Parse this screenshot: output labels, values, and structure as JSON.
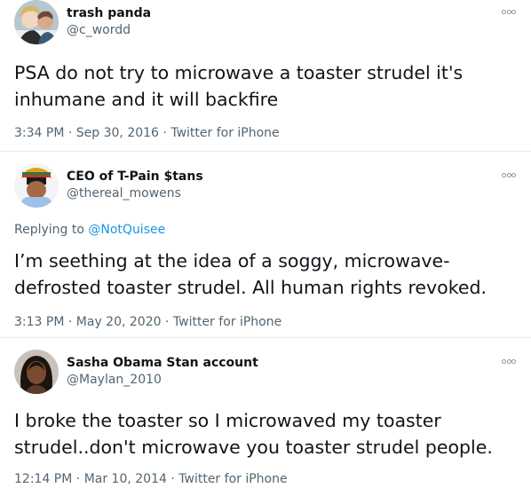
{
  "tweets": [
    {
      "display_name": "trash panda",
      "handle": "@c_wordd",
      "text": "PSA do not try to microwave a toaster strudel it's\ninhumane and it will backfire",
      "time": "3:34 PM",
      "date": "Sep 30, 2016",
      "source": "Twitter for iPhone",
      "separator": "·",
      "more_icon": "more-dots-icon"
    },
    {
      "display_name": "CEO of T-Pain $tans",
      "handle": "@thereal_mowens",
      "replying_prefix": "Replying to",
      "replying_to": "@NotQuisee",
      "text": "I’m seething at the idea of a soggy, microwave-\ndefrosted toaster strudel.  All human rights revoked.",
      "time": "3:13 PM",
      "date": "May 20, 2020",
      "source": "Twitter for iPhone",
      "separator": "·",
      "more_icon": "more-dots-icon"
    },
    {
      "display_name": "Sasha Obama Stan account",
      "handle": "@Maylan_2010",
      "text": "I broke the toaster so I microwaved my toaster\nstrudel..don't microwave you toaster strudel people.",
      "time": "12:14 PM",
      "date": "Mar 10, 2014",
      "source": "Twitter for iPhone",
      "separator": "·",
      "more_icon": "more-dots-icon"
    }
  ],
  "colors": {
    "text": "#0f1419",
    "secondary": "#536471",
    "link": "#1b95e0",
    "divider": "#e6ecf0"
  }
}
